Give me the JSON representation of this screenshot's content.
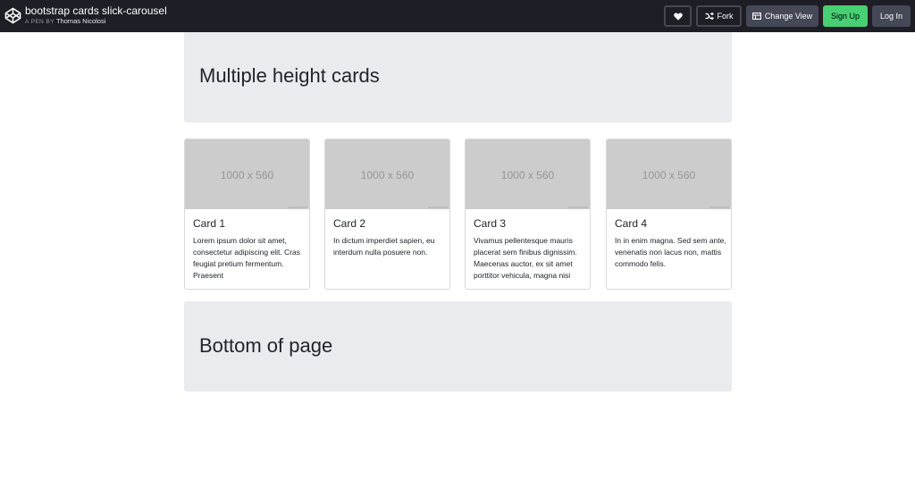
{
  "header": {
    "title": "bootstrap cards slick-carousel",
    "by_label": "A PEN BY",
    "author": "Thomas Nicolosi",
    "buttons": {
      "heart_icon": "heart-icon",
      "fork": "Fork",
      "change_view": "Change View",
      "sign_up": "Sign Up",
      "log_in": "Log In"
    }
  },
  "top_section": {
    "heading": "Multiple height cards"
  },
  "cards": [
    {
      "image_text": "1000 x 560",
      "title": "Card 1",
      "text": "Lorem ipsum dolor sit amet, consectetur adipiscing elit. Cras feugiat pretium fermentum. Praesent"
    },
    {
      "image_text": "1000 x 560",
      "title": "Card 2",
      "text": "In dictum imperdiet sapien, eu interdum nulla posuere non."
    },
    {
      "image_text": "1000 x 560",
      "title": "Card 3",
      "text": "Vivamus pellentesque mauris placerat sem finibus dignissim. Maecenas auctor, ex sit amet porttitor vehicula, magna nisi"
    },
    {
      "image_text": "1000 x 560",
      "title": "Card 4",
      "text": "In in enim magna. Sed sem ante, venenatis non lacus non, mattis commodo felis."
    }
  ],
  "bottom_section": {
    "heading": "Bottom of page"
  },
  "colors": {
    "topbar": "#1e1f26",
    "sign_up": "#47cf73",
    "jumbotron": "#e9ecef",
    "placeholder": "#cccccc"
  }
}
